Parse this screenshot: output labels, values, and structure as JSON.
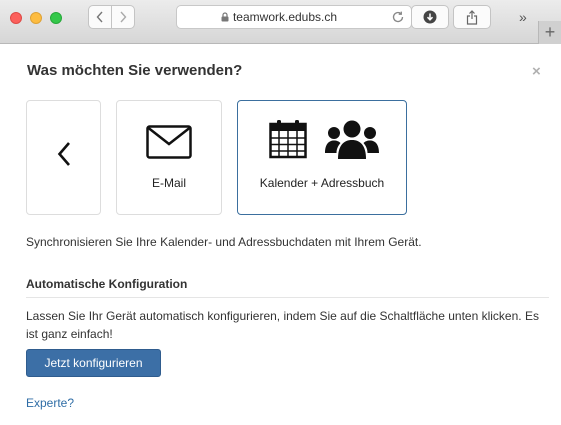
{
  "browser": {
    "url": "teamwork.edubs.ch",
    "more_label": "»",
    "newtab_label": "+"
  },
  "modal": {
    "title": "Was möchten Sie verwenden?",
    "close_label": "×",
    "cards": {
      "back_label": "‹",
      "email_label": "E-Mail",
      "calendar_label": "Kalender + Adressbuch"
    },
    "selected_card": "calendar",
    "description": "Synchronisieren Sie Ihre Kalender- und Adressbuchdaten mit Ihrem Gerät.",
    "auto_config": {
      "heading": "Automatische Konfiguration",
      "text": "Lassen Sie Ihr Gerät automatisch konfigurieren, indem Sie auf die Schaltfläche unten klicken. Es ist ganz einfach!",
      "button_label": "Jetzt konfigurieren"
    },
    "expert_link": "Experte?"
  },
  "colors": {
    "primary": "#3c6fa6",
    "link": "#2f6da6",
    "selected_border": "#3b6f9e"
  }
}
